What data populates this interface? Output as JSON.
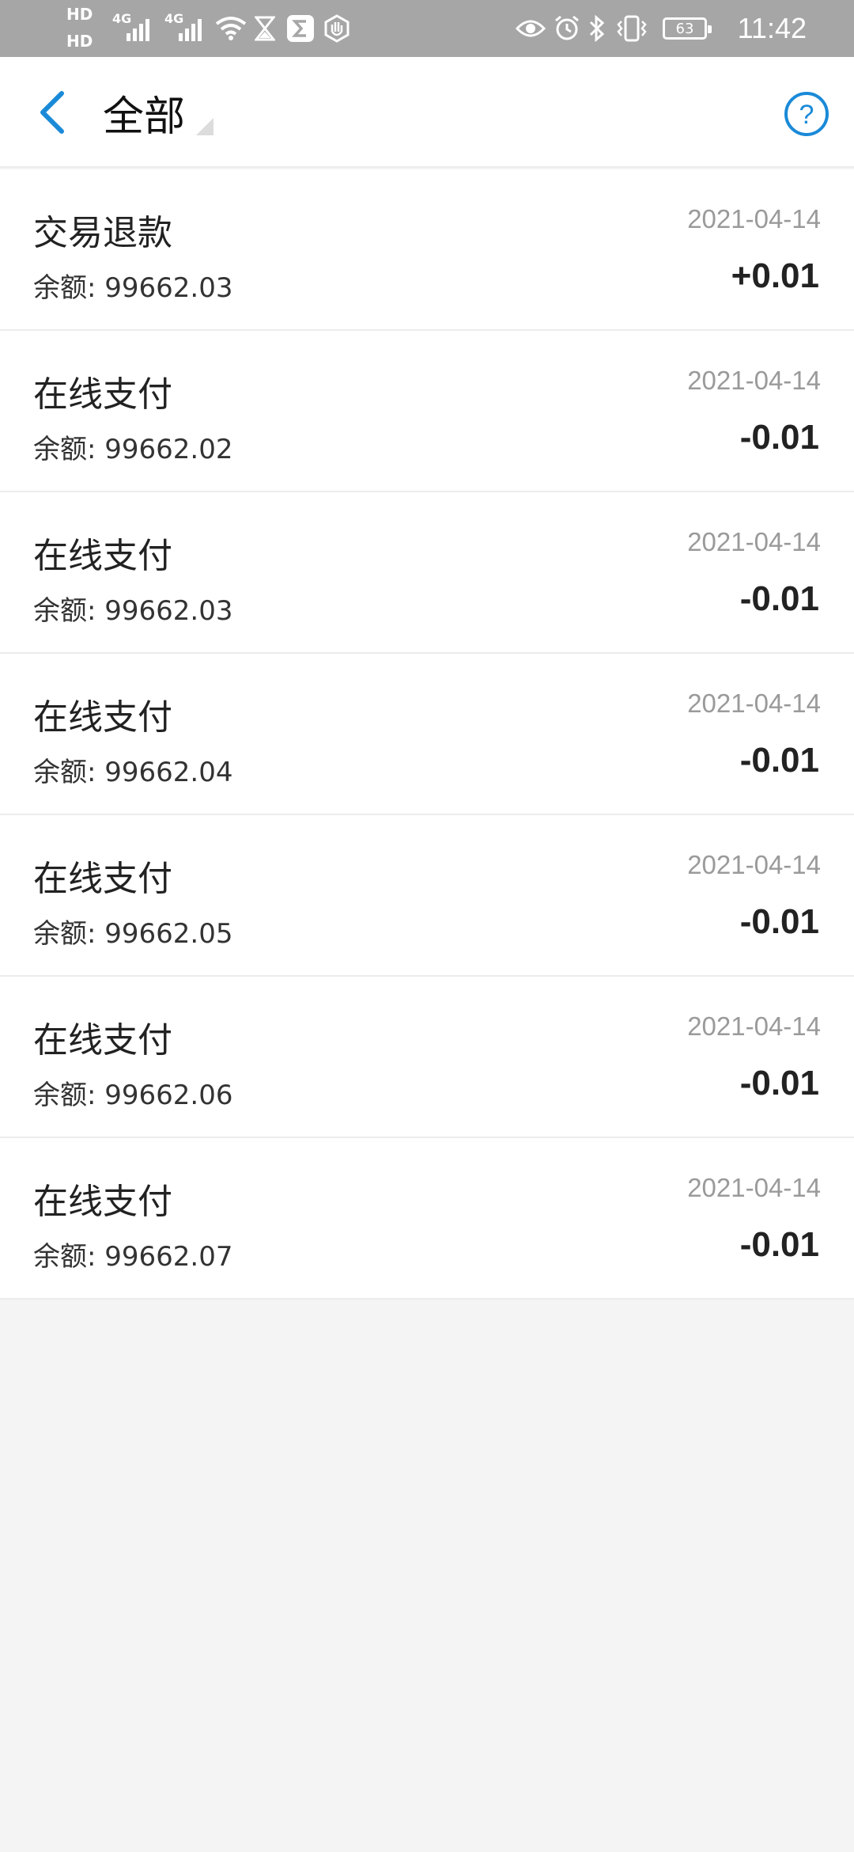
{
  "status_bar": {
    "sim1_label": "HD",
    "sim2_label": "HD",
    "network1": "4G",
    "network2": "4G",
    "battery_level": "63",
    "time": "11:42",
    "icons": [
      "signal-icon",
      "wifi-icon",
      "hourglass-icon",
      "sigma-icon",
      "hand-icon",
      "eye-icon",
      "alarm-icon",
      "bluetooth-icon",
      "vibrate-icon",
      "battery-icon"
    ]
  },
  "header": {
    "title": "全部",
    "back_icon": "chevron-left-icon",
    "help_icon": "question-circle-icon",
    "accent_color": "#1a8ad8"
  },
  "transactions": [
    {
      "title": "交易退款",
      "balance": "余额: 99662.03",
      "date": "2021-04-14",
      "amount": "+0.01"
    },
    {
      "title": "在线支付",
      "balance": "余额: 99662.02",
      "date": "2021-04-14",
      "amount": "-0.01"
    },
    {
      "title": "在线支付",
      "balance": "余额: 99662.03",
      "date": "2021-04-14",
      "amount": "-0.01"
    },
    {
      "title": "在线支付",
      "balance": "余额: 99662.04",
      "date": "2021-04-14",
      "amount": "-0.01"
    },
    {
      "title": "在线支付",
      "balance": "余额: 99662.05",
      "date": "2021-04-14",
      "amount": "-0.01"
    },
    {
      "title": "在线支付",
      "balance": "余额: 99662.06",
      "date": "2021-04-14",
      "amount": "-0.01"
    },
    {
      "title": "在线支付",
      "balance": "余额: 99662.07",
      "date": "2021-04-14",
      "amount": "-0.01"
    }
  ]
}
